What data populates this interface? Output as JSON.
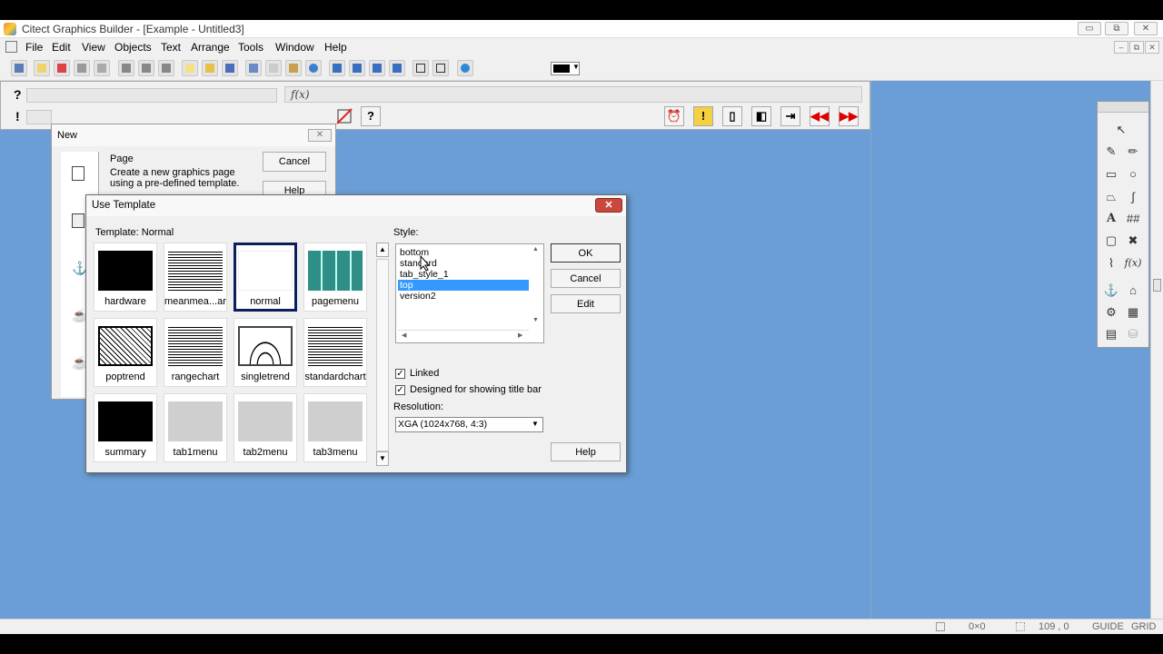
{
  "window": {
    "title": "Citect Graphics Builder - [Example - Untitled3]",
    "min_label": "▭",
    "max_label": "⧉",
    "close_label": "✕"
  },
  "menu": {
    "items": [
      "File",
      "Edit",
      "View",
      "Objects",
      "Text",
      "Arrange",
      "Tools",
      "Window",
      "Help"
    ]
  },
  "propbar": {
    "help_q": "?",
    "help_ex": "!",
    "fx": "f(x)"
  },
  "new_dialog": {
    "title": "New",
    "page_title": "Page",
    "page_desc_1": "Create a new graphics page",
    "page_desc_2": "using a pre-defined template.",
    "cancel": "Cancel",
    "help": "Help"
  },
  "template_dialog": {
    "title": "Use Template",
    "template_label": "Template: Normal",
    "style_label": "Style:",
    "templates": [
      {
        "name": "hardware",
        "preview": "black"
      },
      {
        "name": "meanmea...art",
        "preview": "noise"
      },
      {
        "name": "normal",
        "preview": "white"
      },
      {
        "name": "pagemenu",
        "preview": "teal"
      },
      {
        "name": "poptrend",
        "preview": "trend"
      },
      {
        "name": "rangechart",
        "preview": "noise"
      },
      {
        "name": "singletrend",
        "preview": "wave"
      },
      {
        "name": "standardchart",
        "preview": "noise"
      },
      {
        "name": "summary",
        "preview": "black"
      },
      {
        "name": "tab1menu",
        "preview": "grey"
      },
      {
        "name": "tab2menu",
        "preview": "grey"
      },
      {
        "name": "tab3menu",
        "preview": "grey"
      }
    ],
    "styles": [
      "bottom",
      "standard",
      "tab_style_1",
      "top",
      "version2"
    ],
    "selected_style": "top",
    "buttons": {
      "ok": "OK",
      "cancel": "Cancel",
      "edit": "Edit",
      "help": "Help"
    },
    "linked_label": "Linked",
    "linked_checked": true,
    "titlebar_label": "Designed for showing title bar",
    "titlebar_checked": true,
    "resolution_label": "Resolution:",
    "resolution_value": "XGA (1024x768, 4:3)"
  },
  "statusbar": {
    "size": "0×0",
    "pos": "109 , 0",
    "guide": "GUIDE",
    "grid": "GRID"
  },
  "colors": {
    "workspace": "#6b9ed6",
    "selection": "#3399ff",
    "close_red": "#c9483d"
  }
}
